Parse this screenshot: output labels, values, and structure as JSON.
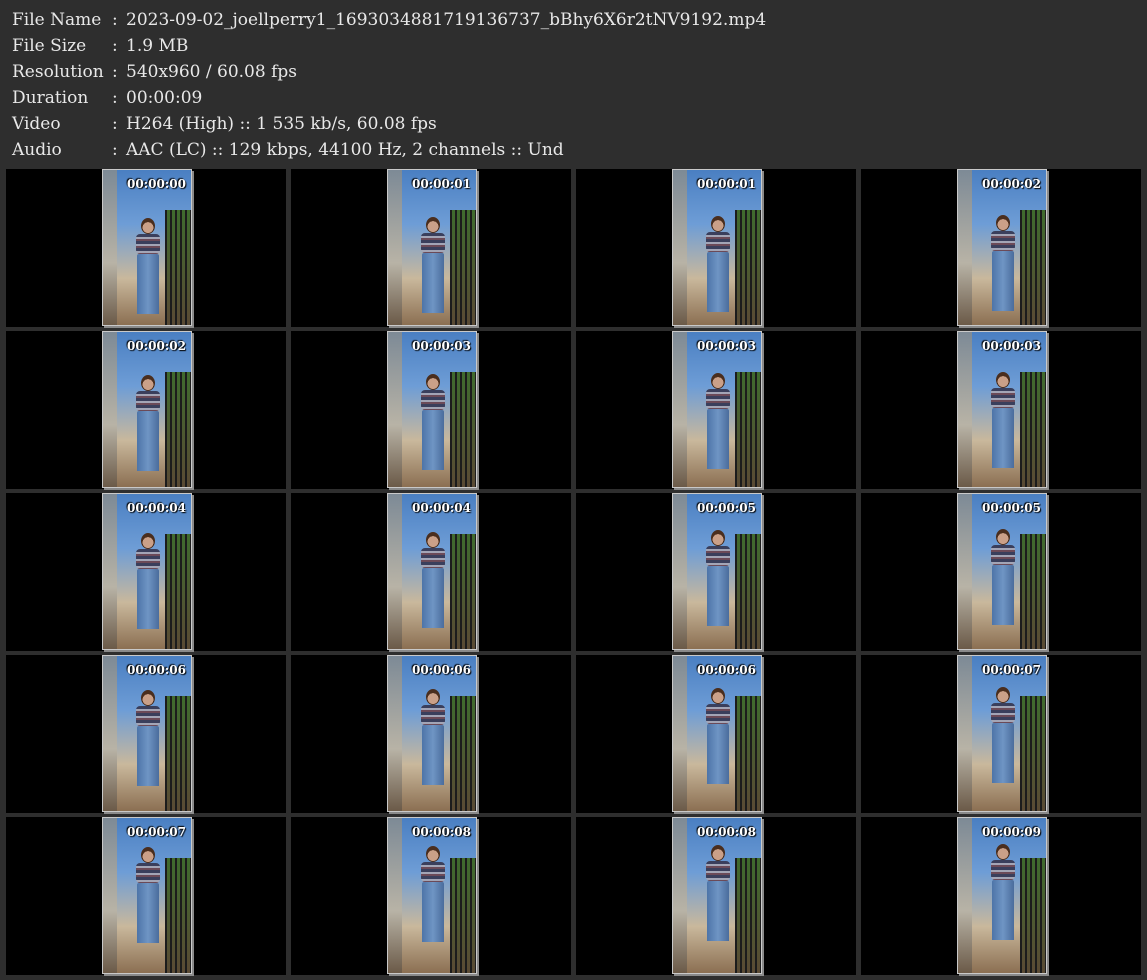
{
  "info": [
    {
      "label": "File Name",
      "sep": ":",
      "value": "2023-09-02_joellperry1_1693034881719136737_bBhy6X6r2tNV9192.mp4"
    },
    {
      "label": "File Size",
      "sep": ":",
      "value": "1.9 MB"
    },
    {
      "label": "Resolution",
      "sep": ":",
      "value": "540x960 / 60.08 fps"
    },
    {
      "label": "Duration",
      "sep": ":",
      "value": "00:00:09"
    },
    {
      "label": "Video",
      "sep": ":",
      "value": "H264 (High) :: 1 535 kb/s, 60.08 fps"
    },
    {
      "label": "Audio",
      "sep": ":",
      "value": "AAC (LC) :: 129 kbps, 44100 Hz, 2 channels :: Und"
    }
  ],
  "thumbnails": [
    "00:00:00",
    "00:00:01",
    "00:00:01",
    "00:00:02",
    "00:00:02",
    "00:00:03",
    "00:00:03",
    "00:00:03",
    "00:00:04",
    "00:00:04",
    "00:00:05",
    "00:00:05",
    "00:00:06",
    "00:00:06",
    "00:00:06",
    "00:00:07",
    "00:00:07",
    "00:00:08",
    "00:00:08",
    "00:00:09"
  ],
  "colors": {
    "background": "#2e2e2e",
    "cell": "#000000",
    "text": "#e8e8e8"
  }
}
